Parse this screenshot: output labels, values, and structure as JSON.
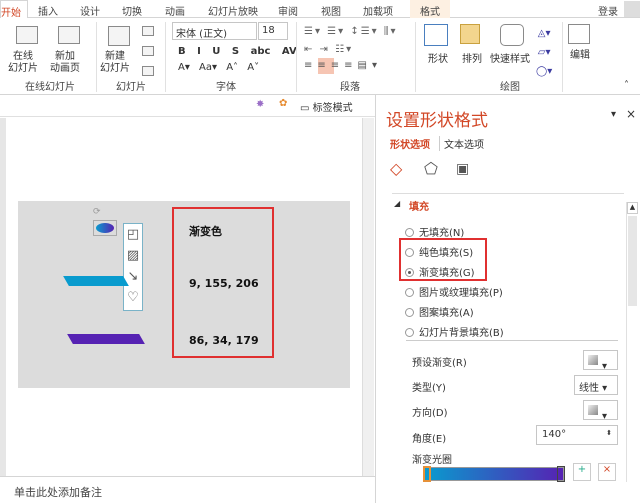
{
  "tabs": [
    "开始",
    "插入",
    "设计",
    "切换",
    "动画",
    "幻灯片放映",
    "审阅",
    "视图",
    "加载项",
    "格式"
  ],
  "login": "登录",
  "ribbon": {
    "online_slide": "在线\n幻灯片",
    "add_anim_page": "新加\n动画页",
    "group_online": "在线幻灯片",
    "new_slide": "新建\n幻灯片",
    "group_slides": "幻灯片",
    "font_name": "宋体 (正文)",
    "font_size": "18",
    "group_font": "字体",
    "group_paragraph": "段落",
    "shape": "形状",
    "arrange": "排列",
    "quick_style": "快速样式",
    "group_drawing": "绘图",
    "edit": "编辑"
  },
  "toolbar": {
    "tag_mode": "标签模式"
  },
  "slide": {
    "title": "渐变色",
    "color1": "9, 155, 206",
    "color2": "86, 34, 179",
    "color1_hex": "#099bce",
    "color2_hex": "#5622b3"
  },
  "notes": "单击此处添加备注",
  "panel": {
    "title": "设置形状格式",
    "tab_shape": "形状选项",
    "tab_text": "文本选项",
    "section_fill": "填充",
    "options": [
      "无填充(N)",
      "纯色填充(S)",
      "渐变填充(G)",
      "图片或纹理填充(P)",
      "图案填充(A)",
      "幻灯片背景填充(B)"
    ],
    "selected": 2,
    "preset": "预设渐变(R)",
    "type": "类型(Y)",
    "type_value": "线性",
    "direction": "方向(D)",
    "angle": "角度(E)",
    "angle_value": "140°",
    "stops": "渐变光圈"
  },
  "accent": "#d24726"
}
